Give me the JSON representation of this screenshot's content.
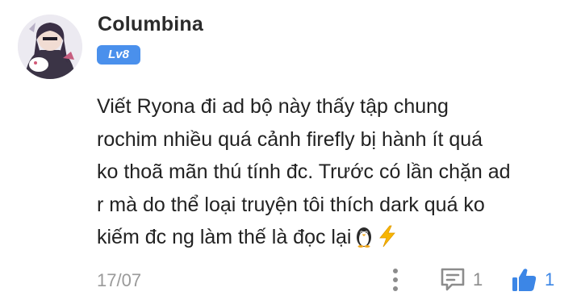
{
  "comment": {
    "username": "Columbina",
    "level": "Lv8",
    "text_lines": [
      "Viết Ryona đi ad bộ này thấy tập chung",
      "rochim nhiều quá cảnh firefly bị hành ít quá",
      "ko thoã mãn thú tính đc. Trước có lần chặn ad",
      "r mà do thể loại truyện tôi thích dark quá ko",
      "kiếm đc ng làm thế là đọc lại"
    ],
    "emojis": [
      "penguin-icon",
      "high-voltage-icon"
    ],
    "date": "17/07",
    "reply_count": "1",
    "like_count": "1"
  },
  "colors": {
    "level_badge": "#4a90ec",
    "like_icon": "#3c86e6",
    "muted_text": "#9a9a9a",
    "icon_gray": "#8c8c8c"
  }
}
